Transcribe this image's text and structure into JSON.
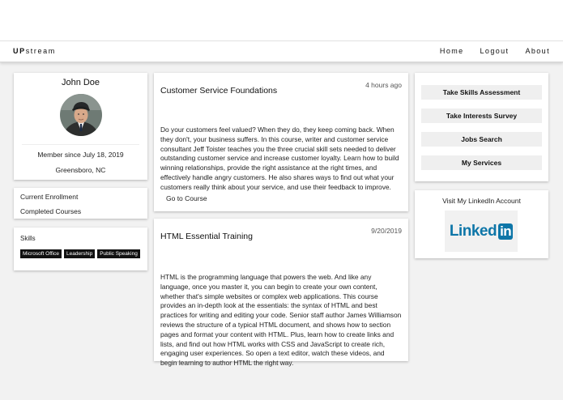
{
  "nav": {
    "brand_bold": "UP",
    "brand_rest": "stream",
    "links": [
      "Home",
      "Logout",
      "About"
    ]
  },
  "profile": {
    "name": "John Doe",
    "member_since": "Member since July 18, 2019",
    "location": "Greensboro, NC"
  },
  "enrollment": {
    "current": "Current Enrollment",
    "completed": "Completed Courses"
  },
  "skills": {
    "title": "Skills",
    "tags": [
      "Microsoft Office",
      "Leadership",
      "Public Speaking"
    ]
  },
  "courses": [
    {
      "title": "Customer Service Foundations",
      "time": "4 hours ago",
      "description": "Do your customers feel valued? When they do, they keep coming back. When they don't, your business suffers. In this course, writer and customer service consultant Jeff Toister teaches you the three crucial skill sets needed to deliver outstanding customer service and increase customer loyalty. Learn how to build winning relationships, provide the right assistance at the right times, and effectively handle angry customers. He also shares ways to find out what your customers really think about your service, and use their feedback to improve.",
      "link": "Go to Course"
    },
    {
      "title": "HTML Essential Training",
      "time": "9/20/2019",
      "description": "HTML is the programming language that powers the web. And like any language, once you master it, you can begin to create your own content, whether that's simple websites or complex web applications. This course provides an in-depth look at the essentials: the syntax of HTML and best practices for writing and editing your code. Senior staff author James Williamson reviews the structure of a typical HTML document, and shows how to section pages and format your content with HTML. Plus, learn how to create links and lists, and find out how HTML works with CSS and JavaScript to create rich, engaging user experiences. So open a text editor, watch these videos, and begin learning to author HTML the right way."
    }
  ],
  "actions": [
    "Take Skills Assessment",
    "Take Interests Survey",
    "Jobs Search",
    "My Services"
  ],
  "linkedin": {
    "title": "Visit My LinkedIn Account",
    "logo_word": "Linked",
    "logo_in": "in",
    "brand_color": "#0e76a8"
  }
}
